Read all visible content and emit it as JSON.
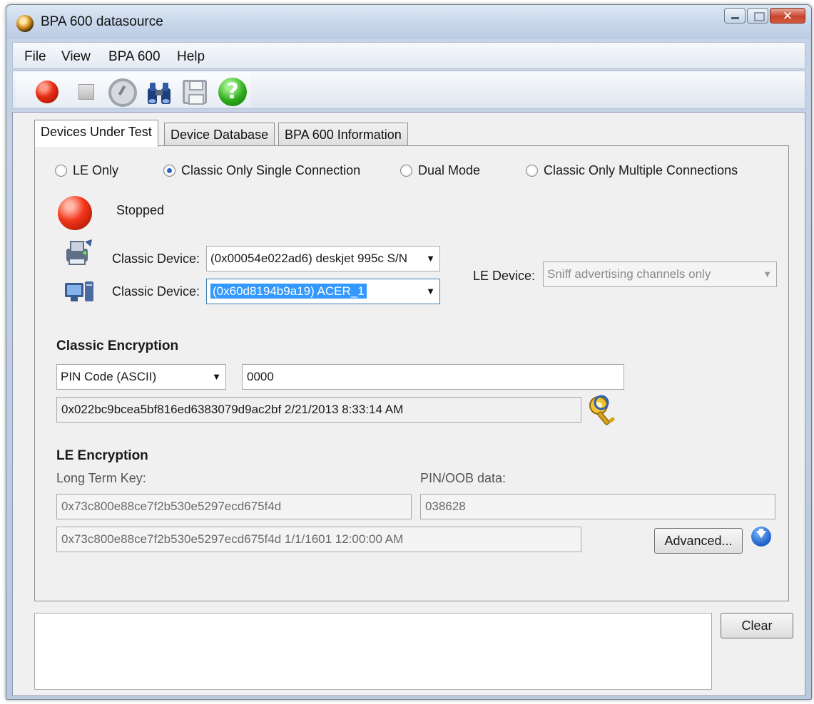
{
  "window": {
    "title": "BPA 600 datasource"
  },
  "menu": [
    "File",
    "View",
    "BPA 600",
    "Help"
  ],
  "toolbar": {
    "icons": [
      "record-icon",
      "stop-icon",
      "clock-icon",
      "binoculars-icon",
      "save-icon",
      "help-icon"
    ]
  },
  "tabs": [
    "Devices Under Test",
    "Device Database",
    "BPA 600 Information"
  ],
  "modes": {
    "le_only": "LE Only",
    "classic_single": "Classic Only Single Connection",
    "dual_mode": "Dual Mode",
    "classic_multiple": "Classic Only Multiple Connections",
    "selected": "classic_single"
  },
  "status": {
    "text": "Stopped",
    "color": "#e52a12"
  },
  "classic_devices": [
    {
      "label": "Classic Device:",
      "value": "(0x00054e022ad6) deskjet 995c S/N"
    },
    {
      "label": "Classic Device:",
      "value": "(0x60d8194b9a19) ACER_1"
    }
  ],
  "le_device": {
    "label": "LE Device:",
    "value": "Sniff advertising channels only"
  },
  "classic_encryption": {
    "heading": "Classic Encryption",
    "pin_type": "PIN Code (ASCII)",
    "pin_value": "0000",
    "link_key": "0x022bc9bcea5bf816ed6383079d9ac2bf 2/21/2013 8:33:14 AM"
  },
  "le_encryption": {
    "heading": "LE Encryption",
    "ltk_label": "Long Term Key:",
    "ltk_value": "0x73c800e88ce7f2b530e5297ecd675f4d",
    "pin_oob_label": "PIN/OOB data:",
    "pin_oob_value": "038628",
    "ltk_history": "0x73c800e88ce7f2b530e5297ecd675f4d 1/1/1601 12:00:00 AM",
    "advanced_button": "Advanced..."
  },
  "log": {
    "clear_button": "Clear"
  }
}
